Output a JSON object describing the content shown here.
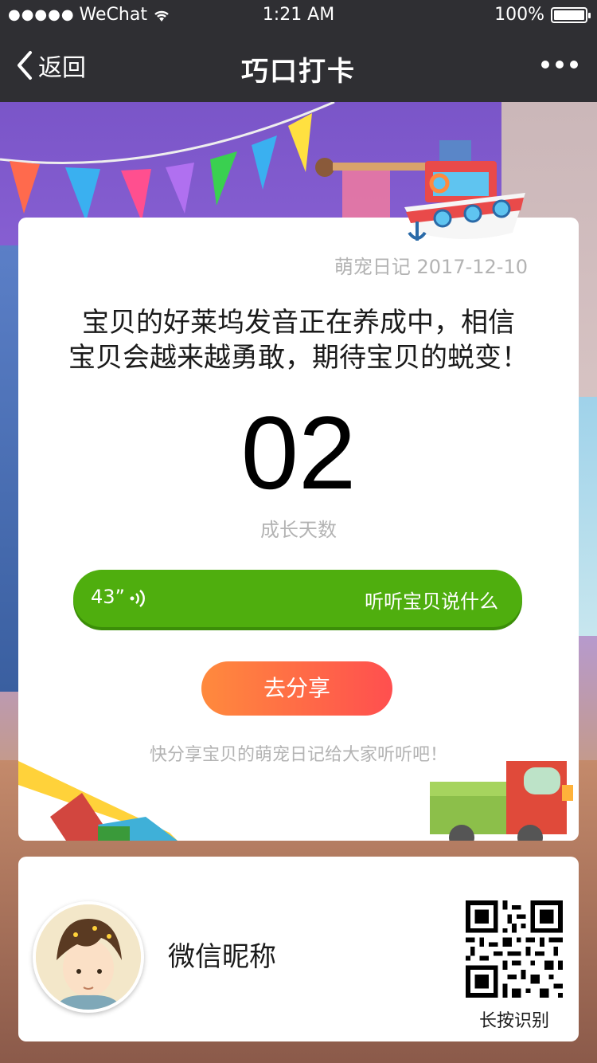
{
  "status_bar": {
    "carrier": "WeChat",
    "time": "1:21 AM",
    "battery": "100%"
  },
  "nav": {
    "back_label": "返回",
    "title": "巧口打卡"
  },
  "card": {
    "date": "萌宠日记 2017-12-10",
    "message_line1": "宝贝的好莱坞发音正在养成中，相信",
    "message_line2": "宝贝会越来越勇敢，期待宝贝的蜕变！",
    "days_count": "02",
    "days_label": "成长天数",
    "voice_duration": "43”",
    "voice_label": "听听宝贝说什么",
    "share_label": "去分享",
    "tip": "快分享宝贝的萌宠日记给大家听听吧！"
  },
  "profile": {
    "nickname": "微信昵称",
    "qr_label": "长按识别"
  },
  "colors": {
    "nav_bg": "#2f2f33",
    "voice_green": "#4fae0e",
    "share_gradient_start": "#ff8a3d",
    "share_gradient_end": "#ff4f4f"
  }
}
